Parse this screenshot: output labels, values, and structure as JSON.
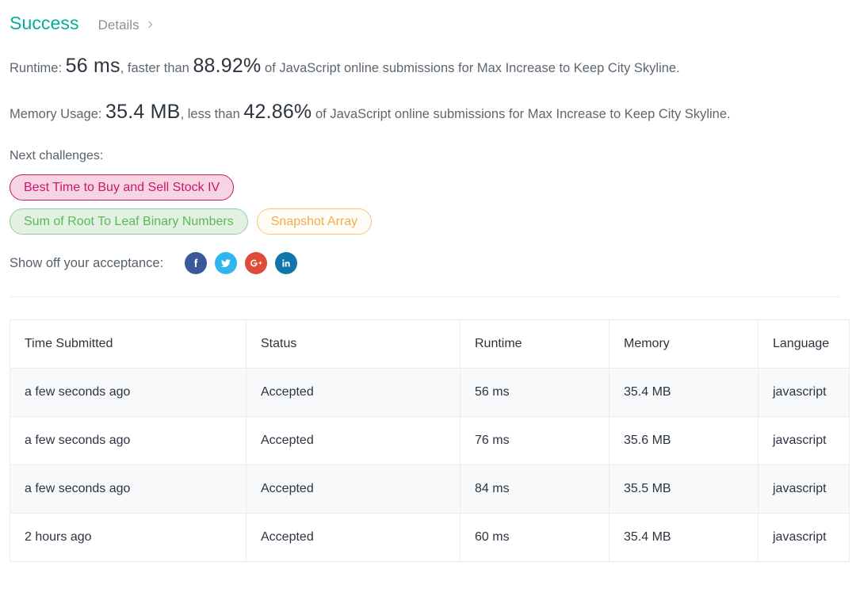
{
  "header": {
    "status": "Success",
    "details_label": "Details",
    "chevron_icon": "chevron-right-icon",
    "success_color": "#00af9b"
  },
  "stats": {
    "runtime": {
      "prefix": "Runtime:",
      "value": "56 ms",
      "middle": ", faster than",
      "percentile": "88.92%",
      "suffix": "of JavaScript online submissions for Max Increase to Keep City Skyline."
    },
    "memory": {
      "prefix": "Memory Usage:",
      "value": "35.4 MB",
      "middle": ", less than",
      "percentile": "42.86%",
      "suffix": "of JavaScript online submissions for Max Increase to Keep City Skyline."
    }
  },
  "next_challenges": {
    "label": "Next challenges:",
    "tags": [
      {
        "label": "Best Time to Buy and Sell Stock IV",
        "difficulty": "hard",
        "color": "#c8186a"
      },
      {
        "label": "Sum of Root To Leaf Binary Numbers",
        "difficulty": "easy",
        "color": "#5cb85c"
      },
      {
        "label": "Snapshot Array",
        "difficulty": "medium",
        "color": "#f0ad4e"
      }
    ]
  },
  "share": {
    "label": "Show off your acceptance:",
    "buttons": [
      {
        "name": "facebook-icon",
        "glyph": "f",
        "color": "#3b5998"
      },
      {
        "name": "twitter-icon",
        "glyph": "t",
        "color": "#30b6ef"
      },
      {
        "name": "google-plus-icon",
        "glyph": "G+",
        "color": "#dd4b39"
      },
      {
        "name": "linkedin-icon",
        "glyph": "in",
        "color": "#0e76a8"
      }
    ]
  },
  "submissions_table": {
    "columns": [
      "Time Submitted",
      "Status",
      "Runtime",
      "Memory",
      "Language"
    ],
    "rows": [
      {
        "time": "a few seconds ago",
        "status": "Accepted",
        "runtime": "56 ms",
        "memory": "35.4 MB",
        "language": "javascript"
      },
      {
        "time": "a few seconds ago",
        "status": "Accepted",
        "runtime": "76 ms",
        "memory": "35.6 MB",
        "language": "javascript"
      },
      {
        "time": "a few seconds ago",
        "status": "Accepted",
        "runtime": "84 ms",
        "memory": "35.5 MB",
        "language": "javascript"
      },
      {
        "time": "2 hours ago",
        "status": "Accepted",
        "runtime": "60 ms",
        "memory": "35.4 MB",
        "language": "javascript"
      }
    ],
    "status_color": "#00af9b"
  }
}
